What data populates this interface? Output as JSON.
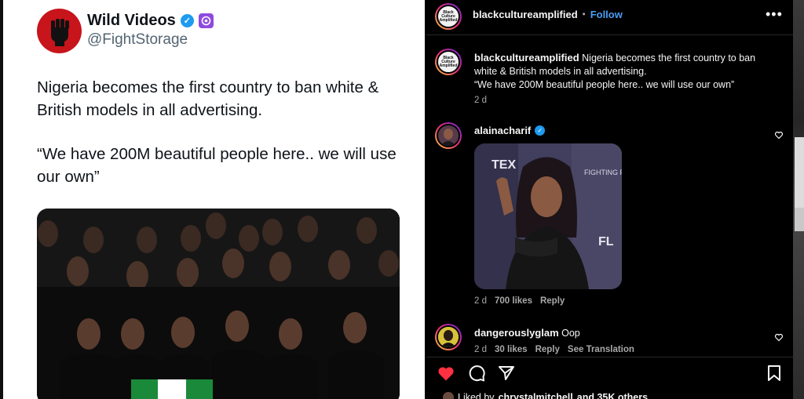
{
  "tweet": {
    "display_name": "Wild Videos",
    "handle": "@FightStorage",
    "text": "Nigeria becomes the first country to ban white & British models in all advertising.",
    "quote": "“We have 200M beautiful people here.. we will use our own”"
  },
  "post": {
    "author": "blackcultureamplified",
    "separator": "•",
    "follow_label": "Follow",
    "avatar_text": "Black Culture Amplified",
    "caption_author": "blackcultureamplified",
    "caption": "Nigeria becomes the first country to ban white & British models in all advertising.",
    "caption_quote": "“We have 200M beautiful people here.. we will use our own”",
    "caption_time": "2 d",
    "more_icon": "more-horizontal-icon"
  },
  "comments": [
    {
      "user": "alainacharif",
      "verified": true,
      "text": "",
      "time": "2 d",
      "likes": "700 likes",
      "reply": "Reply",
      "image_sign_text_1": "FIGHTING FO",
      "image_sign_text_2": "TEX",
      "image_sign_text_3": "FL"
    },
    {
      "user": "dangerouslyglam",
      "verified": false,
      "text": "Oop",
      "time": "2 d",
      "likes": "30 likes",
      "reply": "Reply",
      "translate": "See Translation"
    }
  ],
  "actions": {
    "liked_by": "Liked by",
    "liked_user": "chrystalmitchell",
    "others": "and 35K others",
    "like_color": "#ff3040"
  },
  "colors": {
    "twitter_blue": "#1d9bf0",
    "ig_link": "#4a9cf5",
    "ig_bg": "#000000"
  }
}
